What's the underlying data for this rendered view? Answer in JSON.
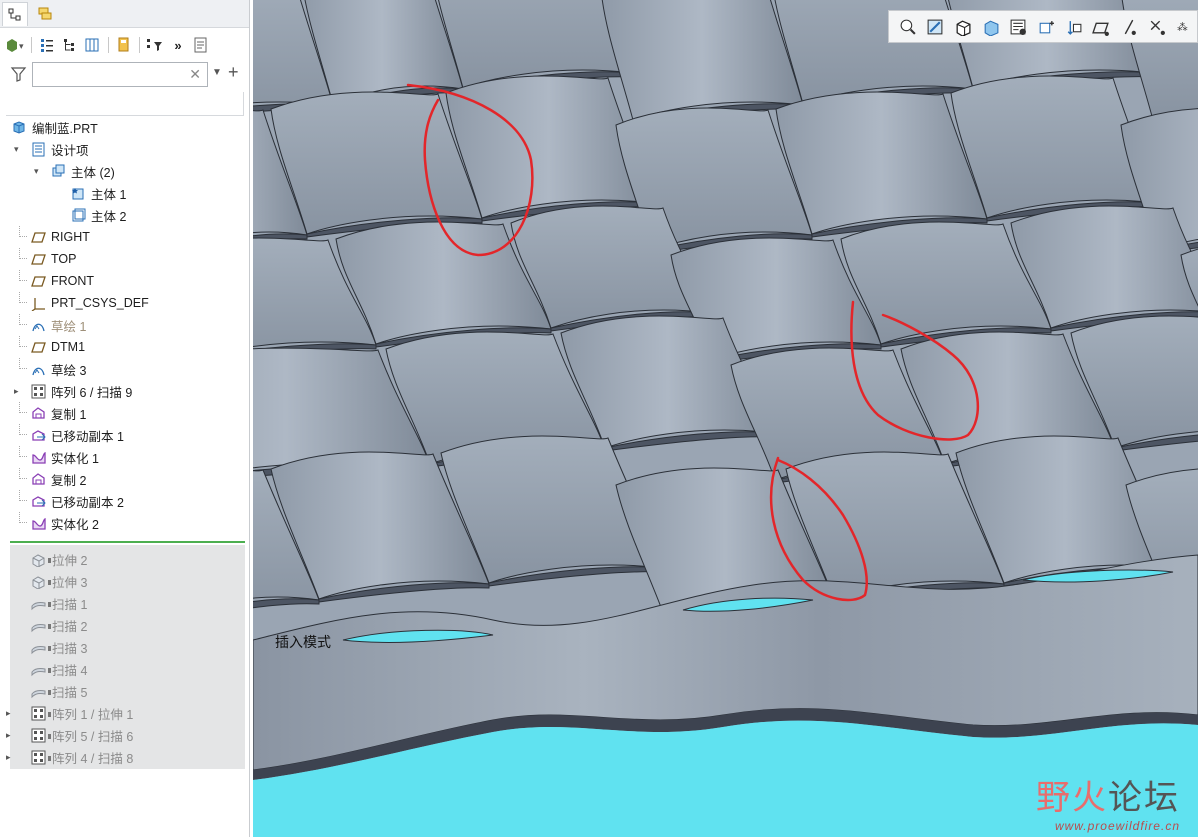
{
  "panel_tabs": [
    {
      "name": "model-tree-tab",
      "icon": "tree-icon"
    },
    {
      "name": "layer-tab",
      "icon": "layers-icon"
    }
  ],
  "search": {
    "placeholder": "",
    "value": ""
  },
  "tree": {
    "root": "编制蓝.PRT",
    "items": [
      {
        "label": "设计项",
        "icon": "design-items-icon",
        "indent": 1,
        "expander": "▾",
        "style": "normal"
      },
      {
        "label": "主体 (2)",
        "icon": "bodies-icon",
        "indent": 2,
        "expander": "▾",
        "style": "normal"
      },
      {
        "label": "主体 1",
        "icon": "body-default-icon",
        "indent": 3,
        "expander": "",
        "style": "normal"
      },
      {
        "label": "主体 2",
        "icon": "body-icon",
        "indent": 3,
        "expander": "",
        "style": "normal"
      },
      {
        "label": "RIGHT",
        "icon": "datum-plane-icon",
        "indent": 1,
        "expander": "",
        "style": "normal"
      },
      {
        "label": "TOP",
        "icon": "datum-plane-icon",
        "indent": 1,
        "expander": "",
        "style": "normal"
      },
      {
        "label": "FRONT",
        "icon": "datum-plane-icon",
        "indent": 1,
        "expander": "",
        "style": "normal"
      },
      {
        "label": "PRT_CSYS_DEF",
        "icon": "csys-icon",
        "indent": 1,
        "expander": "",
        "style": "normal"
      },
      {
        "label": "草绘 1",
        "icon": "sketch-icon",
        "indent": 1,
        "expander": "",
        "style": "dim"
      },
      {
        "label": "DTM1",
        "icon": "datum-plane-icon",
        "indent": 1,
        "expander": "",
        "style": "normal"
      },
      {
        "label": "草绘 3",
        "icon": "sketch-icon",
        "indent": 1,
        "expander": "",
        "style": "normal"
      },
      {
        "label": "阵列 6 / 扫描 9",
        "icon": "pattern-icon",
        "indent": 1,
        "expander": "▸",
        "style": "normal"
      },
      {
        "label": "复制 1",
        "icon": "copy-icon",
        "indent": 1,
        "expander": "",
        "style": "normal"
      },
      {
        "label": "已移动副本 1",
        "icon": "moved-copy-icon",
        "indent": 1,
        "expander": "",
        "style": "normal"
      },
      {
        "label": "实体化 1",
        "icon": "solidify-icon",
        "indent": 1,
        "expander": "",
        "style": "normal"
      },
      {
        "label": "复制 2",
        "icon": "copy-icon",
        "indent": 1,
        "expander": "",
        "style": "normal"
      },
      {
        "label": "已移动副本 2",
        "icon": "moved-copy-icon",
        "indent": 1,
        "expander": "",
        "style": "normal"
      },
      {
        "label": "实体化 2",
        "icon": "solidify-icon",
        "indent": 1,
        "expander": "",
        "style": "normal"
      }
    ],
    "suppressed_items": [
      {
        "label": "拉伸 2",
        "icon": "extrude-icon",
        "expander": ""
      },
      {
        "label": "拉伸 3",
        "icon": "extrude-icon",
        "expander": ""
      },
      {
        "label": "扫描 1",
        "icon": "sweep-icon",
        "expander": ""
      },
      {
        "label": "扫描 2",
        "icon": "sweep-icon",
        "expander": ""
      },
      {
        "label": "扫描 3",
        "icon": "sweep-icon",
        "expander": ""
      },
      {
        "label": "扫描 4",
        "icon": "sweep-icon",
        "expander": ""
      },
      {
        "label": "扫描 5",
        "icon": "sweep-icon",
        "expander": ""
      },
      {
        "label": "阵列 1 / 拉伸 1",
        "icon": "pattern-icon",
        "expander": "▸"
      },
      {
        "label": "阵列 5 / 扫描 6",
        "icon": "pattern-icon",
        "expander": "▸"
      },
      {
        "label": "阵列 4 / 扫描 8",
        "icon": "pattern-icon",
        "expander": "▸"
      }
    ]
  },
  "viewport": {
    "mode_label": "插入模式",
    "toolbar_icons": [
      "zoom-fit-icon",
      "zoom-in-icon",
      "refit-icon",
      "display-style-icon",
      "saved-views-icon",
      "view-manager-icon",
      "perspective-icon",
      "spin-center-icon",
      "datum-plane-display-icon",
      "datum-axis-display-icon",
      "datum-point-display-icon"
    ],
    "colors": {
      "surface": "#9ba6b4",
      "cavity": "#5fe0ee",
      "annotation": "#e3262a"
    }
  },
  "watermark": {
    "title_part1": "野火",
    "title_part2": "论坛",
    "url": "www.proewildfire.cn"
  }
}
